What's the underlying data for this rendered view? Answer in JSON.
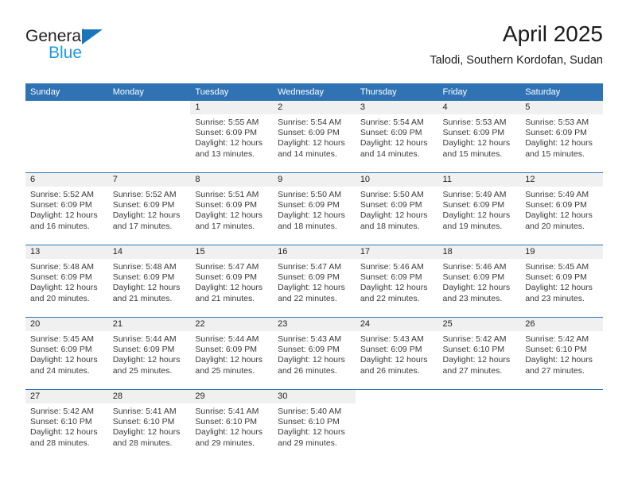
{
  "brand": {
    "name_part1": "General",
    "name_part2": "Blue",
    "accent_color": "#1b75bb",
    "blue_text_color": "#1b9ae5"
  },
  "header": {
    "month_title": "April 2025",
    "location": "Talodi, Southern Kordofan, Sudan"
  },
  "calendar": {
    "header_bg": "#2f73b4",
    "daynum_band_bg": "#f0f0f0",
    "weekday_headers": [
      "Sunday",
      "Monday",
      "Tuesday",
      "Wednesday",
      "Thursday",
      "Friday",
      "Saturday"
    ],
    "weeks": [
      [
        {
          "day": "",
          "sunrise": "",
          "sunset": "",
          "daylight_line1": "",
          "daylight_line2": "",
          "blank": true
        },
        {
          "day": "",
          "sunrise": "",
          "sunset": "",
          "daylight_line1": "",
          "daylight_line2": "",
          "blank": true
        },
        {
          "day": "1",
          "sunrise": "Sunrise: 5:55 AM",
          "sunset": "Sunset: 6:09 PM",
          "daylight_line1": "Daylight: 12 hours",
          "daylight_line2": "and 13 minutes."
        },
        {
          "day": "2",
          "sunrise": "Sunrise: 5:54 AM",
          "sunset": "Sunset: 6:09 PM",
          "daylight_line1": "Daylight: 12 hours",
          "daylight_line2": "and 14 minutes."
        },
        {
          "day": "3",
          "sunrise": "Sunrise: 5:54 AM",
          "sunset": "Sunset: 6:09 PM",
          "daylight_line1": "Daylight: 12 hours",
          "daylight_line2": "and 14 minutes."
        },
        {
          "day": "4",
          "sunrise": "Sunrise: 5:53 AM",
          "sunset": "Sunset: 6:09 PM",
          "daylight_line1": "Daylight: 12 hours",
          "daylight_line2": "and 15 minutes."
        },
        {
          "day": "5",
          "sunrise": "Sunrise: 5:53 AM",
          "sunset": "Sunset: 6:09 PM",
          "daylight_line1": "Daylight: 12 hours",
          "daylight_line2": "and 15 minutes."
        }
      ],
      [
        {
          "day": "6",
          "sunrise": "Sunrise: 5:52 AM",
          "sunset": "Sunset: 6:09 PM",
          "daylight_line1": "Daylight: 12 hours",
          "daylight_line2": "and 16 minutes."
        },
        {
          "day": "7",
          "sunrise": "Sunrise: 5:52 AM",
          "sunset": "Sunset: 6:09 PM",
          "daylight_line1": "Daylight: 12 hours",
          "daylight_line2": "and 17 minutes."
        },
        {
          "day": "8",
          "sunrise": "Sunrise: 5:51 AM",
          "sunset": "Sunset: 6:09 PM",
          "daylight_line1": "Daylight: 12 hours",
          "daylight_line2": "and 17 minutes."
        },
        {
          "day": "9",
          "sunrise": "Sunrise: 5:50 AM",
          "sunset": "Sunset: 6:09 PM",
          "daylight_line1": "Daylight: 12 hours",
          "daylight_line2": "and 18 minutes."
        },
        {
          "day": "10",
          "sunrise": "Sunrise: 5:50 AM",
          "sunset": "Sunset: 6:09 PM",
          "daylight_line1": "Daylight: 12 hours",
          "daylight_line2": "and 18 minutes."
        },
        {
          "day": "11",
          "sunrise": "Sunrise: 5:49 AM",
          "sunset": "Sunset: 6:09 PM",
          "daylight_line1": "Daylight: 12 hours",
          "daylight_line2": "and 19 minutes."
        },
        {
          "day": "12",
          "sunrise": "Sunrise: 5:49 AM",
          "sunset": "Sunset: 6:09 PM",
          "daylight_line1": "Daylight: 12 hours",
          "daylight_line2": "and 20 minutes."
        }
      ],
      [
        {
          "day": "13",
          "sunrise": "Sunrise: 5:48 AM",
          "sunset": "Sunset: 6:09 PM",
          "daylight_line1": "Daylight: 12 hours",
          "daylight_line2": "and 20 minutes."
        },
        {
          "day": "14",
          "sunrise": "Sunrise: 5:48 AM",
          "sunset": "Sunset: 6:09 PM",
          "daylight_line1": "Daylight: 12 hours",
          "daylight_line2": "and 21 minutes."
        },
        {
          "day": "15",
          "sunrise": "Sunrise: 5:47 AM",
          "sunset": "Sunset: 6:09 PM",
          "daylight_line1": "Daylight: 12 hours",
          "daylight_line2": "and 21 minutes."
        },
        {
          "day": "16",
          "sunrise": "Sunrise: 5:47 AM",
          "sunset": "Sunset: 6:09 PM",
          "daylight_line1": "Daylight: 12 hours",
          "daylight_line2": "and 22 minutes."
        },
        {
          "day": "17",
          "sunrise": "Sunrise: 5:46 AM",
          "sunset": "Sunset: 6:09 PM",
          "daylight_line1": "Daylight: 12 hours",
          "daylight_line2": "and 22 minutes."
        },
        {
          "day": "18",
          "sunrise": "Sunrise: 5:46 AM",
          "sunset": "Sunset: 6:09 PM",
          "daylight_line1": "Daylight: 12 hours",
          "daylight_line2": "and 23 minutes."
        },
        {
          "day": "19",
          "sunrise": "Sunrise: 5:45 AM",
          "sunset": "Sunset: 6:09 PM",
          "daylight_line1": "Daylight: 12 hours",
          "daylight_line2": "and 23 minutes."
        }
      ],
      [
        {
          "day": "20",
          "sunrise": "Sunrise: 5:45 AM",
          "sunset": "Sunset: 6:09 PM",
          "daylight_line1": "Daylight: 12 hours",
          "daylight_line2": "and 24 minutes."
        },
        {
          "day": "21",
          "sunrise": "Sunrise: 5:44 AM",
          "sunset": "Sunset: 6:09 PM",
          "daylight_line1": "Daylight: 12 hours",
          "daylight_line2": "and 25 minutes."
        },
        {
          "day": "22",
          "sunrise": "Sunrise: 5:44 AM",
          "sunset": "Sunset: 6:09 PM",
          "daylight_line1": "Daylight: 12 hours",
          "daylight_line2": "and 25 minutes."
        },
        {
          "day": "23",
          "sunrise": "Sunrise: 5:43 AM",
          "sunset": "Sunset: 6:09 PM",
          "daylight_line1": "Daylight: 12 hours",
          "daylight_line2": "and 26 minutes."
        },
        {
          "day": "24",
          "sunrise": "Sunrise: 5:43 AM",
          "sunset": "Sunset: 6:09 PM",
          "daylight_line1": "Daylight: 12 hours",
          "daylight_line2": "and 26 minutes."
        },
        {
          "day": "25",
          "sunrise": "Sunrise: 5:42 AM",
          "sunset": "Sunset: 6:10 PM",
          "daylight_line1": "Daylight: 12 hours",
          "daylight_line2": "and 27 minutes."
        },
        {
          "day": "26",
          "sunrise": "Sunrise: 5:42 AM",
          "sunset": "Sunset: 6:10 PM",
          "daylight_line1": "Daylight: 12 hours",
          "daylight_line2": "and 27 minutes."
        }
      ],
      [
        {
          "day": "27",
          "sunrise": "Sunrise: 5:42 AM",
          "sunset": "Sunset: 6:10 PM",
          "daylight_line1": "Daylight: 12 hours",
          "daylight_line2": "and 28 minutes."
        },
        {
          "day": "28",
          "sunrise": "Sunrise: 5:41 AM",
          "sunset": "Sunset: 6:10 PM",
          "daylight_line1": "Daylight: 12 hours",
          "daylight_line2": "and 28 minutes."
        },
        {
          "day": "29",
          "sunrise": "Sunrise: 5:41 AM",
          "sunset": "Sunset: 6:10 PM",
          "daylight_line1": "Daylight: 12 hours",
          "daylight_line2": "and 29 minutes."
        },
        {
          "day": "30",
          "sunrise": "Sunrise: 5:40 AM",
          "sunset": "Sunset: 6:10 PM",
          "daylight_line1": "Daylight: 12 hours",
          "daylight_line2": "and 29 minutes."
        },
        {
          "day": "",
          "sunrise": "",
          "sunset": "",
          "daylight_line1": "",
          "daylight_line2": "",
          "blank": true
        },
        {
          "day": "",
          "sunrise": "",
          "sunset": "",
          "daylight_line1": "",
          "daylight_line2": "",
          "blank": true
        },
        {
          "day": "",
          "sunrise": "",
          "sunset": "",
          "daylight_line1": "",
          "daylight_line2": "",
          "blank": true
        }
      ]
    ]
  }
}
